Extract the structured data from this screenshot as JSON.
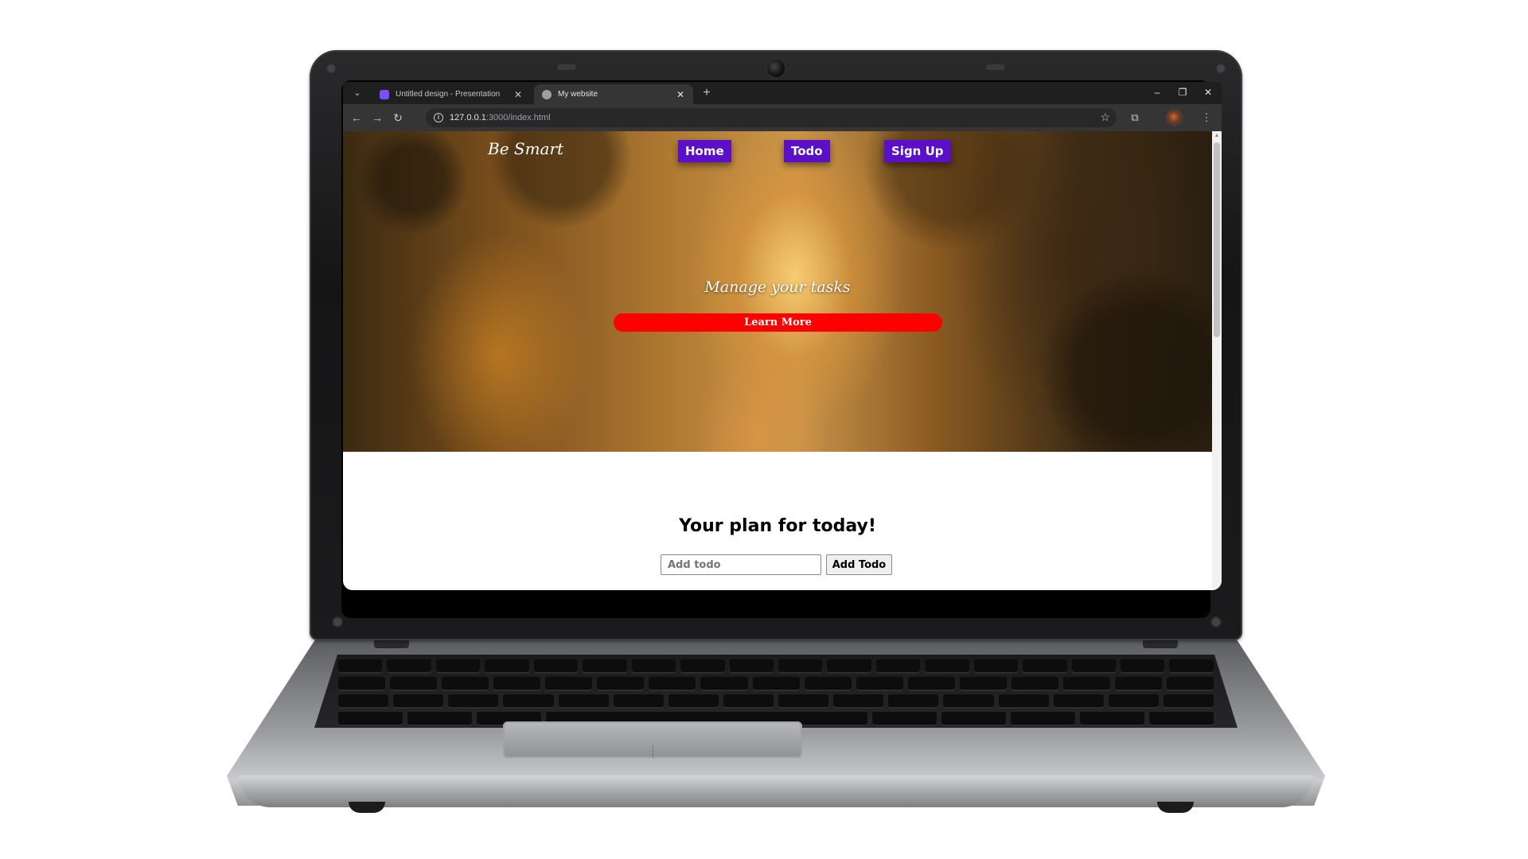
{
  "browser": {
    "tabs": [
      {
        "title": "Untitled design - Presentation",
        "favicon_color": "#7b4dff",
        "active": false
      },
      {
        "title": "My website",
        "favicon_color": "#9aa0a6",
        "active": true
      }
    ],
    "new_tab_glyph": "+",
    "window_controls": {
      "minimize": "–",
      "restore": "❐",
      "close": "✕"
    },
    "url_host": "127.0.0.1",
    "url_path": ":3000/index.html",
    "icons": [
      "back-icon",
      "forward-icon",
      "reload-icon",
      "site-info-icon",
      "bookmark-star-icon",
      "extensions-icon",
      "profile-avatar",
      "menu-icon"
    ]
  },
  "site": {
    "brand": "Be Smart",
    "nav": {
      "home": "Home",
      "todo": "Todo",
      "signup": "Sign Up"
    },
    "hero": {
      "tagline": "Manage your tasks",
      "cta_label": "Learn More"
    },
    "todo": {
      "title": "Your plan for today!",
      "input_placeholder": "Add todo",
      "input_value": "",
      "add_label": "Add Todo"
    }
  },
  "colors": {
    "nav_pill": "#5b0fc8",
    "cta": "#ff0000"
  }
}
